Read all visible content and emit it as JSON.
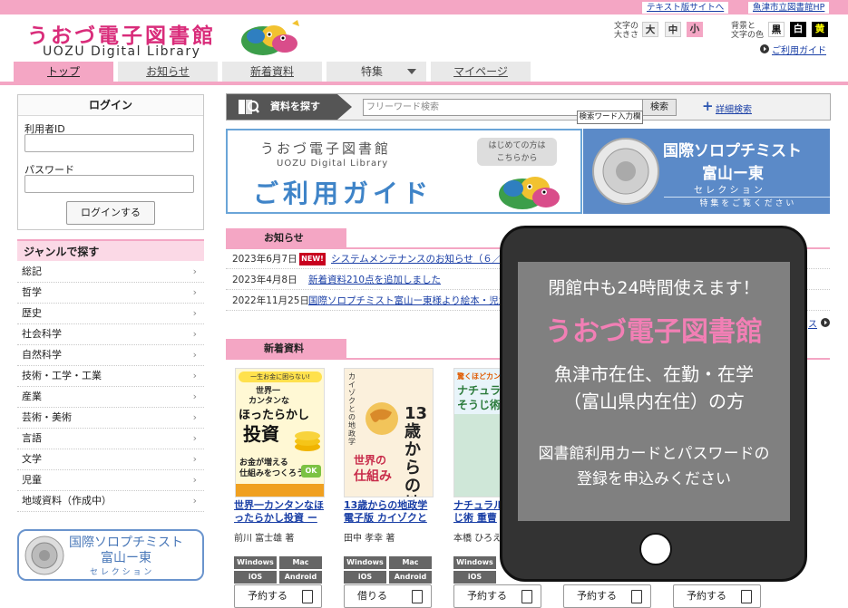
{
  "header": {
    "logo_jp": "うおづ電子図書館",
    "logo_en": "UOZU Digital Library",
    "text_version_link": "テキスト版サイトへ",
    "city_link": "魚津市立図書館HP",
    "font_size_label": [
      "文字の",
      "大きさ"
    ],
    "font_sizes": [
      "大",
      "中",
      "小"
    ],
    "color_label": [
      "背景と",
      "文字の色"
    ],
    "colors": [
      "黒",
      "白",
      "黄"
    ],
    "guide_link": "ご利用ガイド"
  },
  "nav": {
    "tabs": [
      "トップ",
      "お知らせ",
      "新着資料",
      "特集",
      "マイページ"
    ]
  },
  "login": {
    "title": "ログイン",
    "user_label": "利用者ID",
    "password_label": "パスワード",
    "button": "ログインする"
  },
  "genre": {
    "title": "ジャンルで探す",
    "items": [
      "総記",
      "哲学",
      "歴史",
      "社会科学",
      "自然科学",
      "技術・工学・工業",
      "産業",
      "芸術・美術",
      "言語",
      "文学",
      "児童",
      "地域資料（作成中）"
    ]
  },
  "sorop_side": {
    "line1": "国際ソロプチミスト",
    "line2": "富山ー東",
    "line3": "セ レ ク シ ョ ン"
  },
  "search": {
    "label": "資料を探す",
    "placeholder": "フリーワード検索",
    "button": "検索",
    "detail": "詳細検索",
    "tooltip": "検索ワード入力欄"
  },
  "banner_guide": {
    "title_jp": "うおづ電子図書館",
    "title_en": "UOZU Digital Library",
    "guide": "ご利用ガイド",
    "bubble": [
      "はじめての方は",
      "こちらから"
    ]
  },
  "banner_sorop": {
    "line1": "国際ソロプチミスト",
    "line2": "富山ー東",
    "line3": "セ レ ク シ ョ ン",
    "line4": "特 集 を ご 覧 く だ さ い"
  },
  "news": {
    "title": "お知らせ",
    "new_badge": "NEW!",
    "more": "ス",
    "items": [
      {
        "date": "2023年6月7日",
        "text": "システムメンテナンスのお知らせ（６／２",
        "new": true
      },
      {
        "date": "2023年4月8日",
        "text": "新着資料210点を追加しました",
        "new": false
      },
      {
        "date": "2022年11月25日",
        "text": "国際ソロプチミスト富山ー東様より絵本・児童書",
        "new": false
      }
    ]
  },
  "new_items": {
    "title": "新着資料",
    "books": [
      {
        "title": [
          "世界一カンタンなほ",
          "ったらかし投資 ー"
        ],
        "author": "前川 富士雄 著",
        "platforms": [
          "Windows",
          "Mac",
          "iOS",
          "Android"
        ],
        "button": "予約する"
      },
      {
        "title": [
          "13歳からの地政学",
          "電子版 カイゾクと"
        ],
        "author": "田中 孝幸 著",
        "platforms": [
          "Windows",
          "Mac",
          "iOS",
          "Android"
        ],
        "button": "借りる"
      },
      {
        "title": [
          "ナチュラル",
          "じ術 重曹"
        ],
        "author": "本橋 ひろえ",
        "platforms": [
          "Windows",
          "iOS"
        ],
        "button": "予約する"
      },
      {
        "title": [],
        "author": "",
        "platforms": [],
        "button": "予約する"
      },
      {
        "title": [],
        "author": "",
        "platforms": [],
        "button": "予約する"
      }
    ]
  },
  "cover1": {
    "top": "一生お金に困らない!",
    "l1": "世界一",
    "l2": "カンタンな",
    "l3": "ほったらかし",
    "l4": "投資",
    "l5": "お金が増える",
    "l6": "仕組みをつくろう",
    "ok": "OK"
  },
  "cover2": {
    "side": "カイゾクとの地政学",
    "main": "13歳からの地政学",
    "l1": "世界の",
    "l2": "仕組み"
  },
  "cover3": {
    "l1": "驚くほどカンタン",
    "l2": "ナチュラル",
    "l3": "そうじ術"
  },
  "popup": {
    "line1": "閉館中も24時間使えます！",
    "line2": "うおづ電子図書館",
    "line3": "魚津市在住、在勤・在学",
    "line4": "（富山県内在住）の方",
    "line5": "図書館利用カードとパスワードの",
    "line6": "登録を申込みください"
  },
  "colors": {
    "pink": "#f4a6c4",
    "logo_pink": "#d92c7a",
    "link_blue": "#1a3fa6",
    "banner_blue": "#5b8ac8"
  }
}
